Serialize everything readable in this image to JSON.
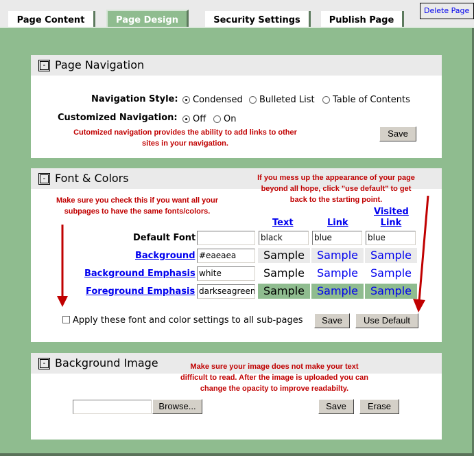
{
  "tabs": [
    {
      "label": "Page Content",
      "active": false
    },
    {
      "label": "Page Design",
      "active": true
    },
    {
      "label": "Security Settings",
      "active": false
    },
    {
      "label": "Publish Page",
      "active": false
    }
  ],
  "delete_page_label": "Delete Page",
  "collapse_symbol": "-",
  "page_navigation": {
    "title": "Page Navigation",
    "navigation_style_label": "Navigation Style:",
    "navigation_style_options": [
      {
        "label": "Condensed",
        "selected": true
      },
      {
        "label": "Bulleted List",
        "selected": false
      },
      {
        "label": "Table of Contents",
        "selected": false
      }
    ],
    "customized_navigation_label": "Customized Navigation:",
    "customized_navigation_options": [
      {
        "label": "Off",
        "selected": true
      },
      {
        "label": "On",
        "selected": false
      }
    ],
    "note_line1": "Cutomized navigation provides the ability to add links to other",
    "note_line2": "sites in your navigation.",
    "save_label": "Save"
  },
  "font_colors": {
    "title": "Font & Colors",
    "note_left_line1": "Make sure you check this if you want all your",
    "note_left_line2": "subpages to have the same fonts/colors.",
    "note_right_line1": "If you mess up the appearance of your page",
    "note_right_line2": "beyond all hope, click \"use default\" to get",
    "note_right_line3": "back to the starting point.",
    "column_headers": {
      "text": "Text",
      "link": "Link",
      "visited_line1": "Visited",
      "visited_line2": "Link"
    },
    "default_font": {
      "label": "Default Font",
      "value": "",
      "text": "black",
      "link": "blue",
      "visited": "blue"
    },
    "rows": [
      {
        "label": "Background",
        "value": "#eaeaea",
        "bg": "#eaeaea"
      },
      {
        "label": "Background Emphasis",
        "value": "white",
        "bg": "#ffffff"
      },
      {
        "label": "Foreground Emphasis",
        "value": "darkseagreen",
        "bg": "#8fbc8f"
      }
    ],
    "sample_text": "Sample",
    "apply_label": "Apply these font and color settings to all sub-pages",
    "apply_checked": false,
    "save_label": "Save",
    "use_default_label": "Use Default"
  },
  "background_image": {
    "title": "Background Image",
    "note_line1": "Make sure your image does not make your text",
    "note_line2": "difficult to read. After the image is uploaded you can",
    "note_line3": "change the opacity to improve readabilty.",
    "file_value": "",
    "browse_label": "Browse...",
    "save_label": "Save",
    "erase_label": "Erase"
  },
  "colors": {
    "accent_green": "#8fbc8f",
    "panel_header": "#eaeaea",
    "note_red": "#c00000",
    "link_blue": "#0000ee"
  }
}
